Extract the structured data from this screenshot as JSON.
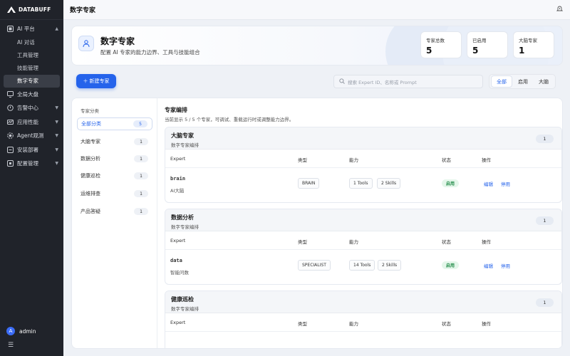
{
  "brand": "DATABUFF",
  "sidebar": {
    "items": [
      {
        "label": "AI 平台",
        "icon": "ai-platform-icon",
        "expanded": true,
        "children": [
          {
            "label": "AI 对话"
          },
          {
            "label": "工具管理"
          },
          {
            "label": "技能管理"
          },
          {
            "label": "数字专家",
            "active": true
          }
        ]
      },
      {
        "label": "全局大盘",
        "icon": "dashboard-icon"
      },
      {
        "label": "告警中心",
        "icon": "alarm-icon"
      },
      {
        "label": "应用性能",
        "icon": "apm-icon"
      },
      {
        "label": "Agent观测",
        "icon": "agent-icon"
      },
      {
        "label": "安装部署",
        "icon": "deploy-icon"
      },
      {
        "label": "配置管理",
        "icon": "config-icon"
      }
    ],
    "user": {
      "initial": "A",
      "name": "admin"
    }
  },
  "topbar": {
    "title": "数字专家"
  },
  "header": {
    "title": "数字专家",
    "subtitle": "配置 AI 专家的能力边界、工具与技能组合",
    "stats": [
      {
        "label": "专家总数",
        "value": "5"
      },
      {
        "label": "已启用",
        "value": "5"
      },
      {
        "label": "大脑专家",
        "value": "1"
      }
    ]
  },
  "toolbar": {
    "new_button": "新建专家",
    "search_placeholder": "搜索 Expert ID、名称或 Prompt",
    "filters": [
      {
        "label": "全部",
        "active": true
      },
      {
        "label": "启用"
      },
      {
        "label": "大脑"
      }
    ]
  },
  "categories": {
    "title": "专家分类",
    "items": [
      {
        "label": "全部分类",
        "count": "5",
        "active": true
      },
      {
        "label": "大脑专家",
        "count": "1"
      },
      {
        "label": "数据分析",
        "count": "1"
      },
      {
        "label": "健康巡检",
        "count": "1"
      },
      {
        "label": "运维排查",
        "count": "1"
      },
      {
        "label": "产品答疑",
        "count": "1"
      }
    ]
  },
  "content": {
    "title": "专家编排",
    "desc": "当前显示 5 / 5 个专家，可调试、重载运行时或调整能力边界。",
    "columns": [
      "Expert",
      "类型",
      "能力",
      "状态",
      "操作"
    ],
    "groups": [
      {
        "name": "大脑专家",
        "sub": "数字专家编排",
        "count": "1",
        "rows": [
          {
            "id": "brain",
            "name": "AI大脑",
            "type": "BRAIN",
            "tools": "1 Tools",
            "skills": "2 Skills",
            "status": "启用",
            "edit": "编辑",
            "disable": "停用"
          }
        ]
      },
      {
        "name": "数据分析",
        "sub": "数字专家编排",
        "count": "1",
        "rows": [
          {
            "id": "data",
            "name": "智能问数",
            "type": "SPECIALIST",
            "tools": "14 Tools",
            "skills": "2 Skills",
            "status": "启用",
            "edit": "编辑",
            "disable": "停用"
          }
        ]
      },
      {
        "name": "健康巡检",
        "sub": "数字专家编排",
        "count": "1",
        "rows": []
      }
    ]
  },
  "colors": {
    "sidebar_bg": "#20232a",
    "accent": "#2563eb",
    "status_green": "#1f8a46"
  }
}
